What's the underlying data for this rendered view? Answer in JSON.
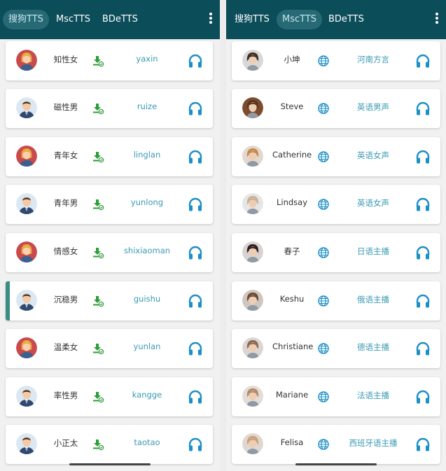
{
  "left_phone": {
    "tabs": [
      {
        "label": "搜狗TTS",
        "active": true
      },
      {
        "label": "MscTTS",
        "active": false
      },
      {
        "label": "BDeTTS",
        "active": false
      }
    ],
    "voices": [
      {
        "name": "知性女",
        "code": "yaxin",
        "gender": "female",
        "selected": false
      },
      {
        "name": "磁性男",
        "code": "ruize",
        "gender": "male",
        "selected": false
      },
      {
        "name": "青年女",
        "code": "linglan",
        "gender": "female",
        "selected": false
      },
      {
        "name": "青年男",
        "code": "yunlong",
        "gender": "male",
        "selected": false
      },
      {
        "name": "情感女",
        "code": "shixiaoman",
        "gender": "female",
        "selected": false
      },
      {
        "name": "沉稳男",
        "code": "guishu",
        "gender": "male",
        "selected": true
      },
      {
        "name": "温柔女",
        "code": "yunlan",
        "gender": "female",
        "selected": false
      },
      {
        "name": "率性男",
        "code": "kangge",
        "gender": "male",
        "selected": false
      },
      {
        "name": "小正太",
        "code": "taotao",
        "gender": "male",
        "selected": false
      }
    ]
  },
  "right_phone": {
    "tabs": [
      {
        "label": "搜狗TTS",
        "active": false
      },
      {
        "label": "MscTTS",
        "active": true
      },
      {
        "label": "BDeTTS",
        "active": false
      }
    ],
    "voices": [
      {
        "name": "小坤",
        "code": "河南方言"
      },
      {
        "name": "Steve",
        "code": "英语男声"
      },
      {
        "name": "Catherine",
        "code": "英语女声"
      },
      {
        "name": "Lindsay",
        "code": "英语女声"
      },
      {
        "name": "春子",
        "code": "日语主播"
      },
      {
        "name": "Keshu",
        "code": "俄语主播"
      },
      {
        "name": "Christiane",
        "code": "德语主播"
      },
      {
        "name": "Mariane",
        "code": "法语主播"
      },
      {
        "name": "Felisa",
        "code": "西班牙语主播"
      }
    ]
  },
  "colors": {
    "appbar": "#0c4d5a",
    "active_tab": "#276a76",
    "download_green": "#2e9d3a",
    "link_teal": "#3a9ab4",
    "play_blue": "#1c8fc6",
    "selected_bar": "#3b8c84"
  },
  "icons": {
    "overflow": "more-vert-icon",
    "download": "download-icon",
    "globe": "globe-icon",
    "play": "headphones-icon"
  }
}
